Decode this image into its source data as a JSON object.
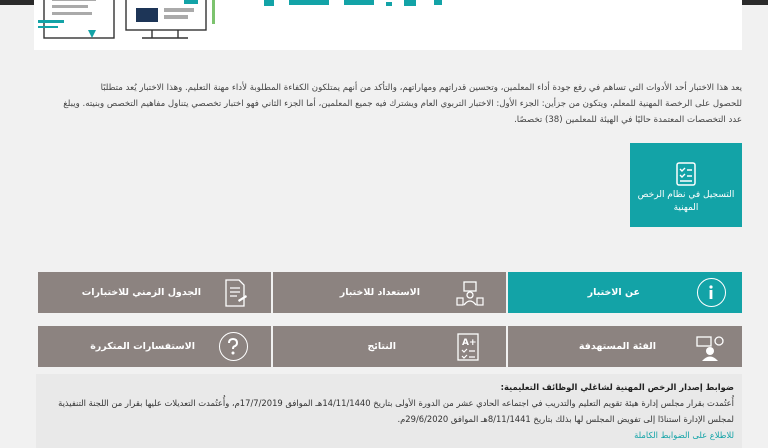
{
  "intro": {
    "line1": "يعد هذا الاختبار أحد الأدوات التي تساهم في رفع جودة أداء المعلمين، وتحسين قدراتهم ومهاراتهم، والتأكد من أنهم يمتلكون الكفاءة المطلوبة لأداء مهنة التعليم. وهذا الاختبار يُعد متطلبًا",
    "line2": "للحصول على الرخصة المهنية للمعلم، ويتكون من جزأين: الجزء الأول: الاختبار التربوي العام ويشترك فيه جميع المعلمين، أما الجزء الثاني فهو اختبار تخصصي يتناول مفاهيم التخصص وبنيته. ويبلغ",
    "line3": "عدد التخصصات المعتمدة حاليًا في الهيئة للمعلمين (38) تخصصًا."
  },
  "register": {
    "label": "التسجيل في نظام الرخص المهنية",
    "icon": "checklist-icon"
  },
  "tiles": {
    "about": {
      "label": "عن الاختبار",
      "icon": "info-icon"
    },
    "prepare": {
      "label": "الاستعداد للاختبار",
      "icon": "study-icon"
    },
    "schedule": {
      "label": "الجدول الزمني للاختبارات",
      "icon": "document-icon"
    },
    "target": {
      "label": "الفئة المستهدفة",
      "icon": "teacher-icon"
    },
    "results": {
      "label": "النتائج",
      "icon": "results-sheet-icon"
    },
    "faq": {
      "label": "الاستفسارات المتكررة",
      "icon": "question-icon"
    }
  },
  "notice": {
    "title": "ضوابط إصدار الرخص المهنية لشاغلي الوظائف التعليمية:",
    "line1": "أُعتُمدت بقرار مجلس إدارة هيئة تقويم التعليم والتدريب في اجتماعه الحادي عشر من الدورة الأولى بتاريخ 14/11/1440هـ الموافق 17/7/2019م، وأُعتُمدت التعديلات عليها بقرار من اللجنة التنفيذية",
    "line2": "لمجلس الإدارة استنادًا إلى تفويض المجلس لها بذلك بتاريخ 8/11/1441هـ الموافق 29/6/2020م.",
    "more": "للاطلاع على الضوابط الكاملة"
  },
  "colors": {
    "teal": "#13a3a7",
    "gray": "#8c8380",
    "background": "#f1f1f1"
  }
}
